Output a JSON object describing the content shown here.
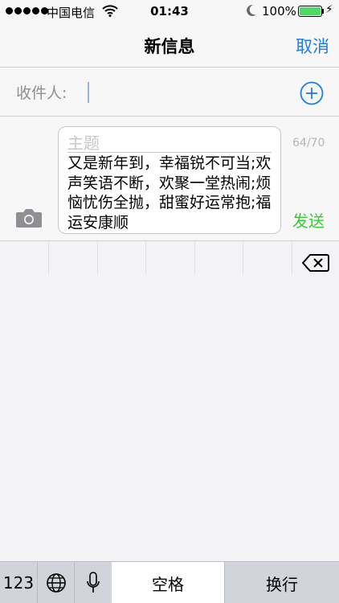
{
  "status_bar": {
    "carrier": "中国电信",
    "time": "01:43",
    "battery_pct": "100%"
  },
  "nav": {
    "title": "新信息",
    "cancel": "取消"
  },
  "recipient": {
    "label": "收件人:"
  },
  "compose": {
    "subject_placeholder": "主题",
    "body": "又是新年到，幸福锐不可当;欢声笑语不断，欢聚一堂热闹;烦恼忧伤全抛，甜蜜好运常抱;福运安康顺",
    "counter": "64/70",
    "send": "发送"
  },
  "keyboard": {
    "numbers_key": "123",
    "space_key": "空格",
    "return_key": "换行"
  },
  "colors": {
    "accent_blue": "#1a7ee8",
    "send_green": "#3ec73a",
    "battery_green": "#4cd964"
  }
}
